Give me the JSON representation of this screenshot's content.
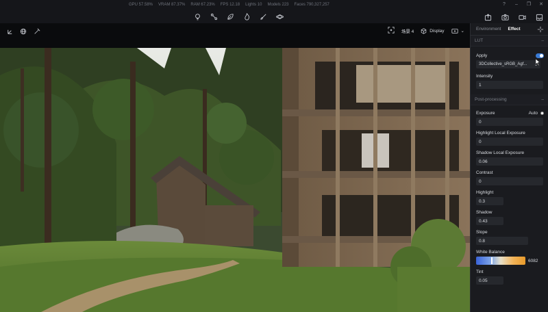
{
  "stats": {
    "gpu": "GPU 57.58%",
    "vram": "VRAM 87.37%",
    "ram": "RAM 67.23%",
    "fps": "FPS 12.18",
    "lights": "Lights 10",
    "models": "Models 223",
    "faces": "Faces 790,327,257"
  },
  "toolbar_icons": [
    "bulb-icon",
    "node-icon",
    "leaf-icon",
    "flame-icon",
    "brush-icon",
    "planet-icon"
  ],
  "viewport_toolbar": {
    "scene_label": "场景 4",
    "display_label": "Display"
  },
  "panel": {
    "tabs": {
      "environment": "Environment",
      "effect": "Effect"
    },
    "lut": {
      "section": "LUT",
      "apply_label": "Apply",
      "apply_on": true,
      "lut_value": "3DCollective_sRGB_Agf...",
      "intensity_label": "Intensity",
      "intensity_value": "1"
    },
    "post": {
      "section": "Post-processing",
      "exposure_label": "Exposure",
      "auto_label": "Auto",
      "exposure_value": "0",
      "highlight_local_label": "Highlight Local Exposure",
      "highlight_local_value": "0",
      "shadow_local_label": "Shadow Local Exposure",
      "shadow_local_value": "0.06",
      "contrast_label": "Contrast",
      "contrast_value": "0",
      "highlight_label": "Highlight",
      "highlight_value": "0.3",
      "shadow_label": "Shadow",
      "shadow_value": "0.43",
      "slope_label": "Slope",
      "slope_value": "0.8",
      "wb_label": "White Balance",
      "wb_value": "6082",
      "tint_label": "Tint",
      "tint_value": "0.05"
    }
  },
  "colors": {
    "accent": "#3a7bd5",
    "panel_bg": "#1a1b1f",
    "topbar_bg": "#15161a"
  }
}
